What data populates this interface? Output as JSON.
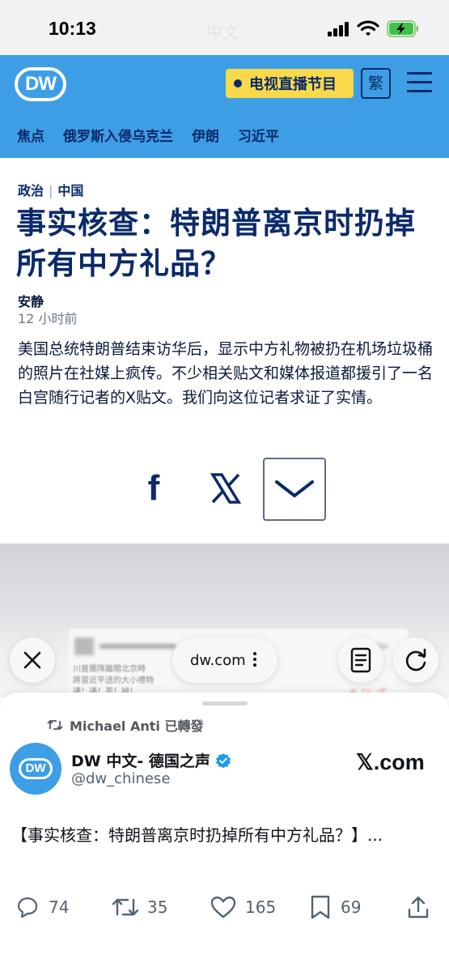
{
  "status_bar": {
    "time": "10:13",
    "ghost_title": "中文"
  },
  "header": {
    "logo": "DW",
    "live_label": "电视直播节目",
    "traditional_label": "繁",
    "topics": [
      "焦点",
      "俄罗斯入侵乌克兰",
      "伊朗",
      "习近平"
    ]
  },
  "article": {
    "crumbs": [
      "政治",
      "中国"
    ],
    "headline": "事实核查：特朗普离京时扔掉所有中方礼品？",
    "author": "安静",
    "time_ago": "12 小时前",
    "lead": "美国总统特朗普结束访华后，显示中方礼物被扔在机场垃圾桶的照片在社媒上疯传。不少相关贴文和媒体报道都援引了一名白宫随行记者的X贴文。我们向这位记者求证了实情。"
  },
  "share": {
    "facebook": "f"
  },
  "image_preview": {
    "text_line1": "川普團隊離開北京時",
    "text_line2": "將習近平送的大小禮物",
    "text_line3": "通！通！丟！掉！",
    "red_text": "# 以 式"
  },
  "browser": {
    "url": "dw.com"
  },
  "tweet": {
    "retweeted_by": "Michael Anti 已轉發",
    "account_name": "DW 中文- 德国之声",
    "handle": "@dw_chinese",
    "brand": "𝕏.com",
    "avatar_logo": "DW",
    "text": "【事实核查：特朗普离京时扔掉所有中方礼品？】...",
    "replies": "74",
    "reposts": "35",
    "likes": "165",
    "bookmarks": "69"
  },
  "colors": {
    "dw_blue": "#3d9ee6",
    "dw_navy": "#0b2a6a",
    "live_yellow": "#f8d94a",
    "verified_blue": "#1d9bf0"
  }
}
